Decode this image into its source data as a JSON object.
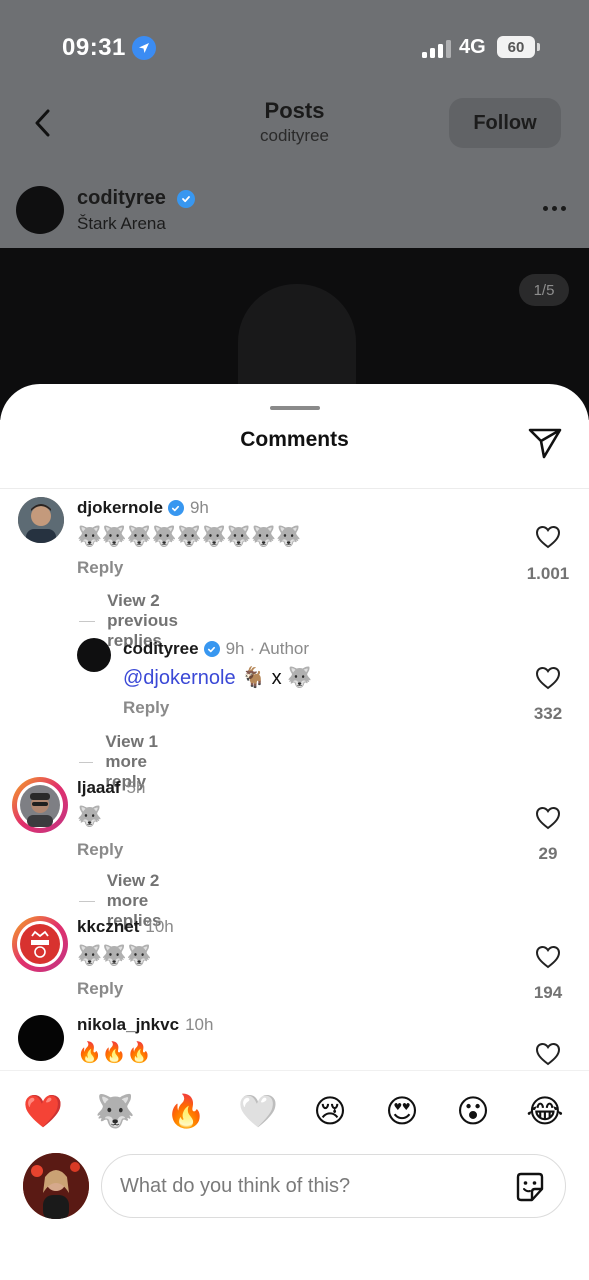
{
  "status_bar": {
    "time": "09:31",
    "network": "4G",
    "battery": "60"
  },
  "header": {
    "title": "Posts",
    "subtitle": "codityree",
    "follow_label": "Follow"
  },
  "post": {
    "username": "codityree",
    "location": "Štark Arena",
    "counter": "1/5"
  },
  "sheet": {
    "title": "Comments"
  },
  "comments": [
    {
      "username": "djokernole",
      "time": "9h",
      "text": "🐺🐺🐺🐺🐺🐺🐺🐺🐺",
      "reply_label": "Reply",
      "likes": "1.001",
      "view_replies": "View 2 previous replies"
    },
    {
      "username": "codityree",
      "time": "9h",
      "author_tag": "· Author",
      "mention": "@djokernole",
      "text": " 🐐 x 🐺",
      "reply_label": "Reply",
      "likes": "332",
      "view_replies": "View 1 more reply"
    },
    {
      "username": "ljaaaf",
      "time": "5h",
      "text": "🐺",
      "reply_label": "Reply",
      "likes": "29",
      "view_replies": "View 2 more replies"
    },
    {
      "username": "kkcznet",
      "time": "10h",
      "text": "🐺🐺🐺",
      "reply_label": "Reply",
      "likes": "194"
    },
    {
      "username": "nikola_jnkvc",
      "time": "10h",
      "text": "🔥🔥🔥"
    }
  ],
  "quick_emojis": [
    "❤️",
    "🐺",
    "🔥",
    "🤍",
    "😢",
    "😍",
    "😮",
    "😂"
  ],
  "composer": {
    "placeholder": "What do you think of this?"
  },
  "colors": {
    "verified": "#3897f0",
    "mention": "#3b49d6",
    "location_arrow": "#3b8cf3"
  },
  "icons": [
    "location-arrow-icon",
    "back-chevron-icon",
    "verified-badge-icon",
    "more-icon",
    "send-icon",
    "heart-icon",
    "sticker-icon"
  ]
}
